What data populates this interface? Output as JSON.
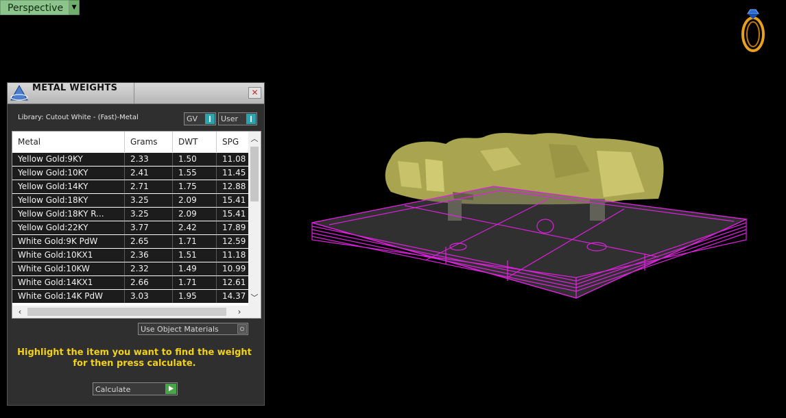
{
  "viewport": {
    "view_label": "Perspective"
  },
  "panel": {
    "title": "METAL WEIGHTS",
    "library": "Library: Cutout White - (Fast)-Metal",
    "toggle_gv": "GV",
    "toggle_user": "User",
    "columns": [
      "Metal",
      "Grams",
      "DWT",
      "SPG"
    ],
    "rows": [
      {
        "metal": "Yellow Gold:9KY",
        "grams": "2.33",
        "dwt": "1.50",
        "spg": "11.08"
      },
      {
        "metal": "Yellow Gold:10KY",
        "grams": "2.41",
        "dwt": "1.55",
        "spg": "11.45"
      },
      {
        "metal": "Yellow Gold:14KY",
        "grams": "2.71",
        "dwt": "1.75",
        "spg": "12.88"
      },
      {
        "metal": "Yellow Gold:18KY",
        "grams": "3.25",
        "dwt": "2.09",
        "spg": "15.41"
      },
      {
        "metal": "Yellow Gold:18KY R...",
        "grams": "3.25",
        "dwt": "2.09",
        "spg": "15.41"
      },
      {
        "metal": "Yellow Gold:22KY",
        "grams": "3.77",
        "dwt": "2.42",
        "spg": "17.89"
      },
      {
        "metal": "White Gold:9K PdW",
        "grams": "2.65",
        "dwt": "1.71",
        "spg": "12.59"
      },
      {
        "metal": "White Gold:10KX1",
        "grams": "2.36",
        "dwt": "1.51",
        "spg": "11.18"
      },
      {
        "metal": "White Gold:10KW",
        "grams": "2.32",
        "dwt": "1.49",
        "spg": "10.99"
      },
      {
        "metal": "White Gold:14KX1",
        "grams": "2.66",
        "dwt": "1.71",
        "spg": "12.61"
      },
      {
        "metal": "White Gold:14K PdW",
        "grams": "3.03",
        "dwt": "1.95",
        "spg": "14.37"
      }
    ],
    "use_object_materials": "Use Object Materials",
    "hint_line1": "Highlight the item you want to find the weight",
    "hint_line2": "for then press calculate.",
    "calculate_label": "Calculate"
  },
  "colors": {
    "accent_toggle": "#2aa5b0",
    "hint": "#f3d21a",
    "wireframe": "#e020e0",
    "model": "#b7b35a"
  }
}
